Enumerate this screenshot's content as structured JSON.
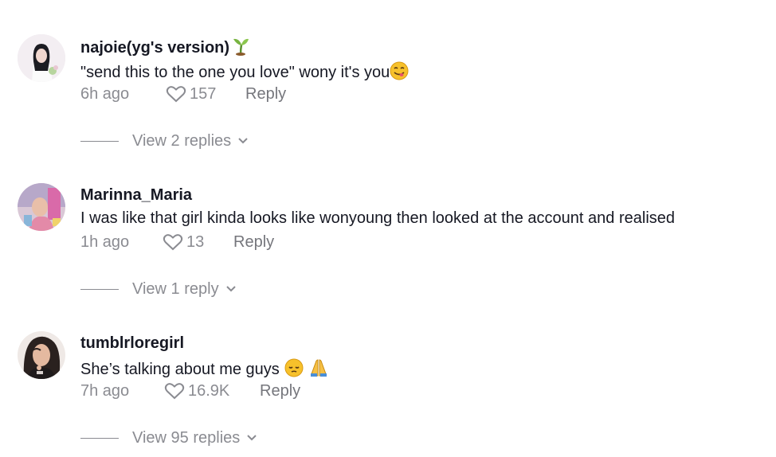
{
  "comments": [
    {
      "username": "najoie(yg's version)",
      "username_emoji": "sprout-icon",
      "text": "\"send this to the one you love\" wony it's you",
      "text_emoji": "yum-face-icon",
      "time": "6h ago",
      "likes": "157",
      "reply_label": "Reply",
      "view_replies": "View 2 replies"
    },
    {
      "username": "Marinna_Maria",
      "text": "I was like that girl kinda looks like wonyoung then looked at the account and realised",
      "time": "1h ago",
      "likes": "13",
      "reply_label": "Reply",
      "view_replies": "View 1 reply"
    },
    {
      "username": "tumblrloregirl",
      "text": "She’s talking about me guys",
      "text_emoji": [
        "pensive-face-icon",
        "folded-hands-icon"
      ],
      "time": "7h ago",
      "likes": "16.9K",
      "reply_label": "Reply",
      "view_replies": "View 95 replies"
    }
  ],
  "colors": {
    "text": "#161823",
    "muted": "#8a8b91"
  }
}
